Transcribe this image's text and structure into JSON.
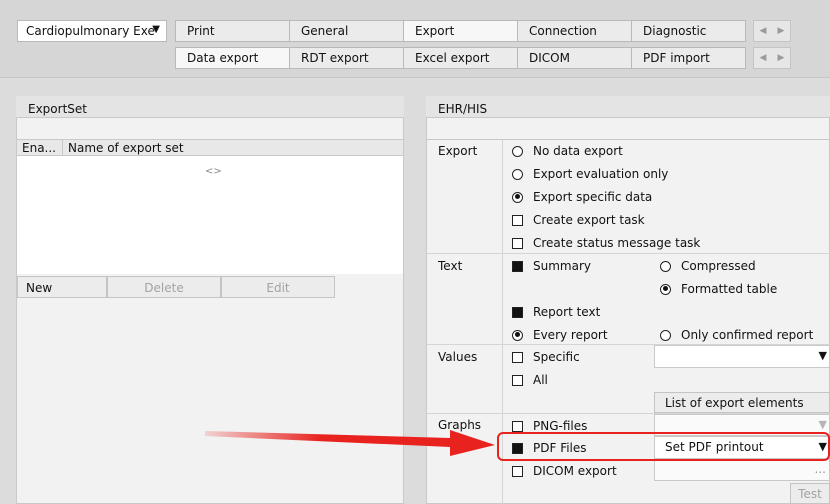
{
  "profile_select": {
    "value": "Cardiopulmonary Exe",
    "arrow": "▼"
  },
  "tabs_row1": [
    "Print",
    "General",
    "Export",
    "Connection",
    "Diagnostic"
  ],
  "tabs_row2": [
    "Data export",
    "RDT export",
    "Excel export",
    "DICOM",
    "PDF import"
  ],
  "scroll_arrows": {
    "left": "◀",
    "right": "▶"
  },
  "left_panel": {
    "title": "ExportSet",
    "columns": [
      "Ena...",
      "Name of export set"
    ],
    "placeholder": "<>",
    "buttons": {
      "new": "New",
      "delete": "Delete",
      "edit": "Edit"
    }
  },
  "right_panel": {
    "title": "EHR/HIS",
    "export": {
      "label": "Export",
      "options": [
        "No data export",
        "Export evaluation only",
        "Export specific data"
      ],
      "selected_option": "Export specific data",
      "tasks": [
        "Create export task",
        "Create status message task"
      ]
    },
    "text": {
      "label": "Text",
      "summary": "Summary",
      "compressed": "Compressed",
      "formatted_table": "Formatted table",
      "report_text": "Report text",
      "every_report": "Every report",
      "only_confirmed": "Only confirmed report"
    },
    "values": {
      "label": "Values",
      "specific": "Specific",
      "all": "All",
      "list_button": "List of export elements"
    },
    "graphs": {
      "label": "Graphs",
      "png": "PNG-files",
      "pdf": "PDF Files",
      "pdf_select": "Set PDF printout",
      "dicom": "DICOM export",
      "dots": "...",
      "test": "Test"
    }
  },
  "colors": {
    "arrow": "#e8231f",
    "highlight": "#e8231f"
  }
}
